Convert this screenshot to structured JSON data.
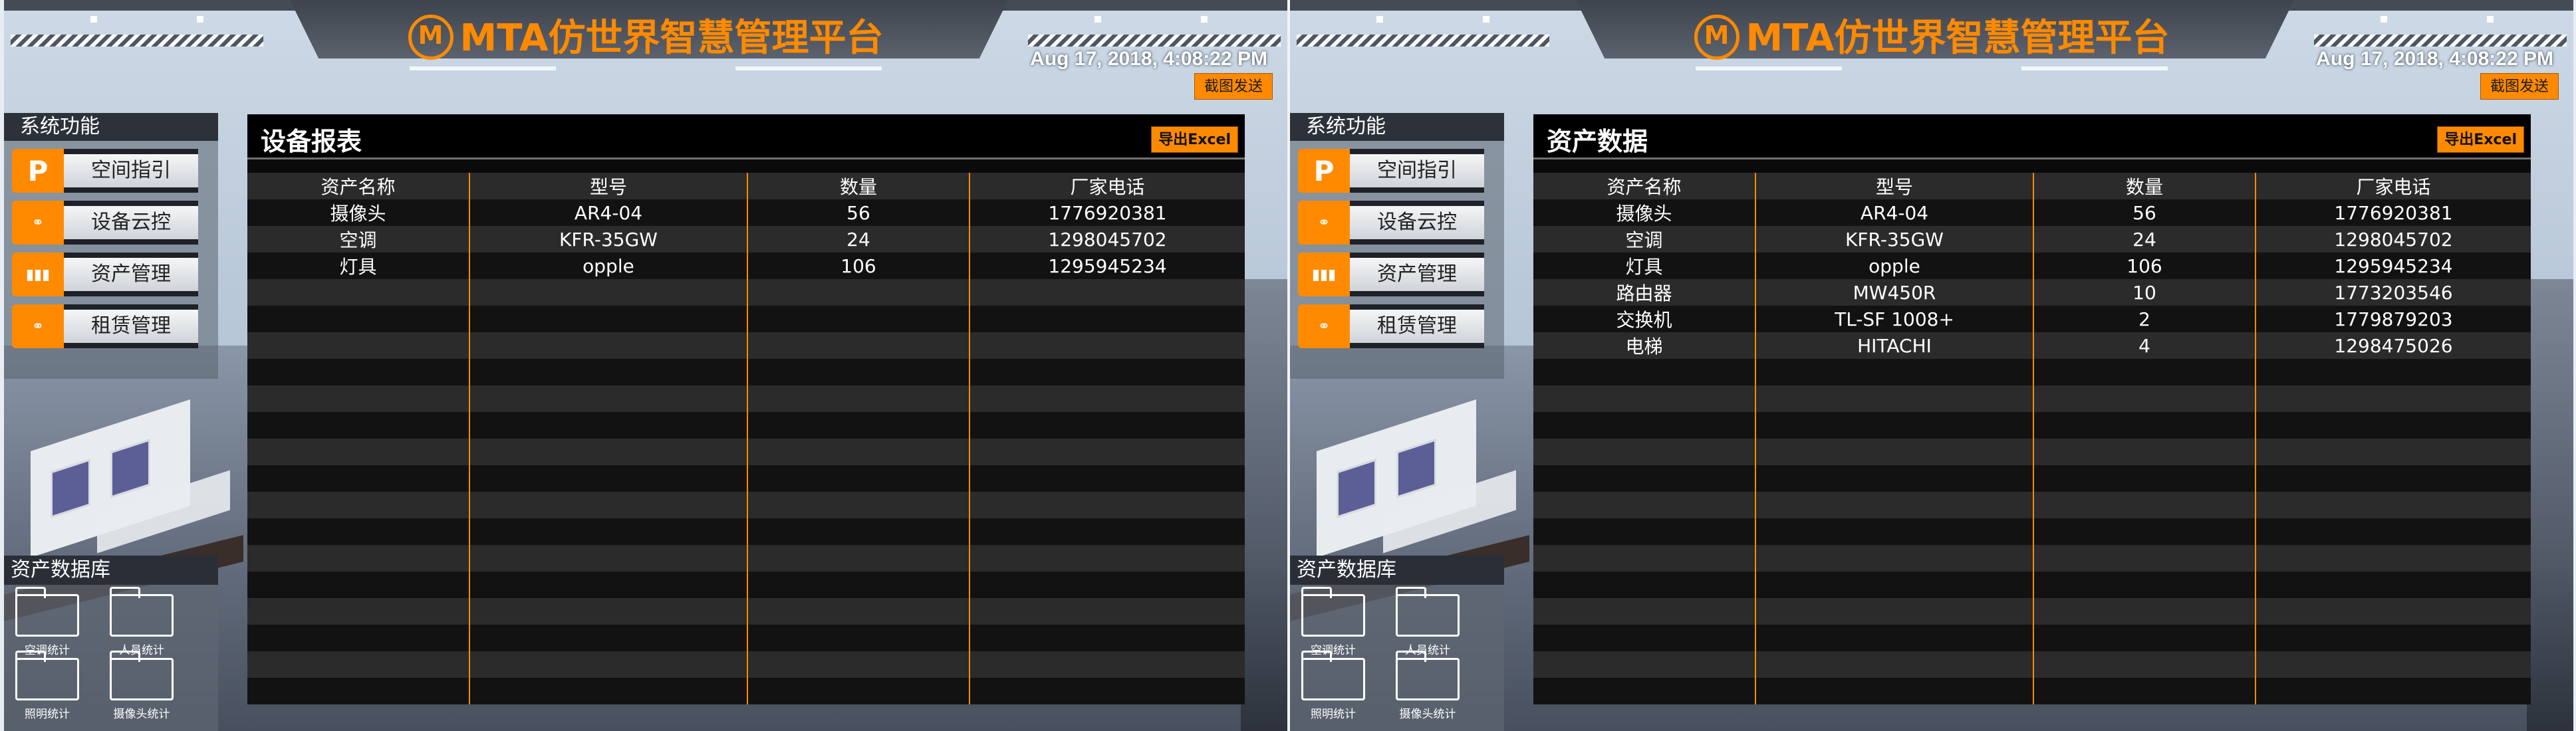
{
  "header": {
    "title": "MTA仿世界智慧管理平台",
    "datetime": "Aug 17, 2018, 4:08:22 PM",
    "screenshot_button": "截图发送"
  },
  "sidebar": {
    "title": "系统功能",
    "items": [
      {
        "label": "空间指引",
        "icon": "P"
      },
      {
        "label": "设备云控",
        "icon": "cloud-control"
      },
      {
        "label": "资产管理",
        "icon": "bar-chart"
      },
      {
        "label": "租赁管理",
        "icon": "lease"
      }
    ]
  },
  "database": {
    "title": "资产数据库",
    "folders": [
      "空调统计",
      "人员统计",
      "照明统计",
      "摄像头统计"
    ]
  },
  "panels": [
    {
      "window_title": "设备报表",
      "export_button": "导出Excel",
      "columns": [
        "资产名称",
        "型号",
        "数量",
        "厂家电话"
      ],
      "rows": [
        [
          "摄像头",
          "AR4-04",
          "56",
          "1776920381"
        ],
        [
          "空调",
          "KFR-35GW",
          "24",
          "1298045702"
        ],
        [
          "灯具",
          "opple",
          "106",
          "1295945234"
        ]
      ]
    },
    {
      "window_title": "资产数据",
      "export_button": "导出Excel",
      "columns": [
        "资产名称",
        "型号",
        "数量",
        "厂家电话"
      ],
      "rows": [
        [
          "摄像头",
          "AR4-04",
          "56",
          "1776920381"
        ],
        [
          "空调",
          "KFR-35GW",
          "24",
          "1298045702"
        ],
        [
          "灯具",
          "opple",
          "106",
          "1295945234"
        ],
        [
          "路由器",
          "MW450R",
          "10",
          "1773203546"
        ],
        [
          "交换机",
          "TL-SF 1008+",
          "2",
          "1779879203"
        ],
        [
          "电梯",
          "HITACHI",
          "4",
          "1298475026"
        ]
      ]
    }
  ],
  "colors": {
    "accent": "#ff8a00",
    "table_dark": "#121212",
    "table_light": "#2b2b2b"
  }
}
